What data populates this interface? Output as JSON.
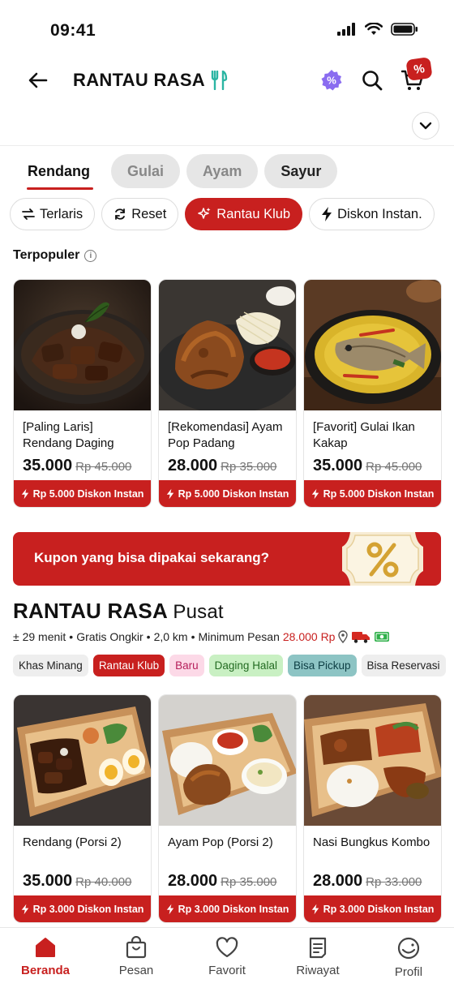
{
  "status_bar": {
    "time": "09:41"
  },
  "header": {
    "title": "RANTAU RASA"
  },
  "tabs": [
    {
      "label": "Rendang",
      "active": true
    },
    {
      "label": "Gulai",
      "active": false
    },
    {
      "label": "Ayam",
      "active": false
    },
    {
      "label": "Sayur",
      "active": false
    }
  ],
  "filters": [
    {
      "label": "Terlaris"
    },
    {
      "label": "Reset"
    },
    {
      "label": "Rantau Klub"
    },
    {
      "label": "Diskon Instan."
    }
  ],
  "popular": {
    "title": "Terpopuler",
    "items": [
      {
        "name": "[Paling Laris] Rendang Daging",
        "price": "35.000",
        "old_price": "Rp 45.000",
        "discount": "Rp 5.000 Diskon Instan"
      },
      {
        "name": "[Rekomendasi] Ayam Pop Padang",
        "price": "28.000",
        "old_price": "Rp 35.000",
        "discount": "Rp 5.000 Diskon Instan"
      },
      {
        "name": "[Favorit] Gulai Ikan Kakap",
        "price": "35.000",
        "old_price": "Rp 45.000",
        "discount": "Rp 5.000 Diskon Instan"
      }
    ]
  },
  "coupon": {
    "text": "Kupon yang bisa dipakai sekarang?"
  },
  "store": {
    "name": "RANTAU RASA",
    "branch": "Pusat",
    "time": "± 29 menit",
    "delivery": "Gratis Ongkir",
    "distance": "2,0 km",
    "min_label": "Minimum Pesan",
    "min_value": "28.000 Rp",
    "tags": [
      "Khas Minang",
      "Rantau Klub",
      "Baru",
      "Daging Halal",
      "Bisa Pickup",
      "Bisa Reservasi"
    ]
  },
  "menu": {
    "items": [
      {
        "name": "Rendang (Porsi 2)",
        "price": "35.000",
        "old_price": "Rp 40.000",
        "discount": "Rp 3.000 Diskon Instan"
      },
      {
        "name": "Ayam Pop (Porsi 2)",
        "price": "28.000",
        "old_price": "Rp 35.000",
        "discount": "Rp 3.000 Diskon Instan"
      },
      {
        "name": "Nasi Bungkus Kombo",
        "price": "28.000",
        "old_price": "Rp 33.000",
        "discount": "Rp 3.000 Diskon Instan"
      }
    ]
  },
  "bottom_nav": [
    {
      "label": "Beranda",
      "icon": "home-icon",
      "active": true
    },
    {
      "label": "Pesan",
      "icon": "bag-icon",
      "active": false
    },
    {
      "label": "Favorit",
      "icon": "heart-icon",
      "active": false
    },
    {
      "label": "Riwayat",
      "icon": "receipt-icon",
      "active": false
    },
    {
      "label": "Profil",
      "icon": "profile-icon",
      "active": false
    }
  ],
  "colors": {
    "accent": "#c8201f",
    "promo_badge": "#8a6cf0"
  }
}
